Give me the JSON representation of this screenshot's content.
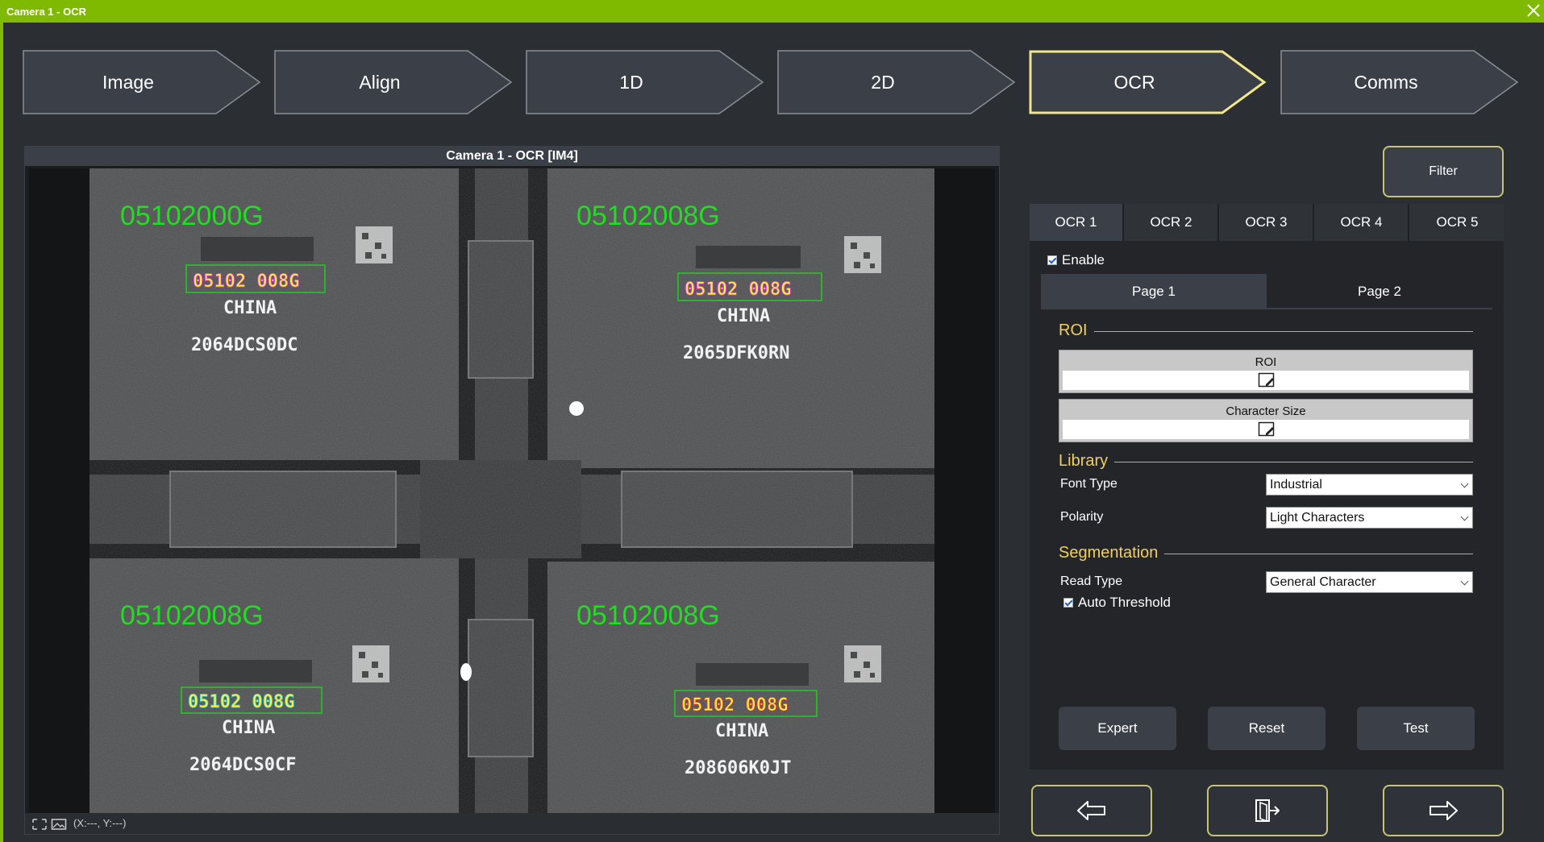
{
  "window": {
    "title": "Camera 1 - OCR"
  },
  "steps": [
    {
      "label": "Image"
    },
    {
      "label": "Align"
    },
    {
      "label": "1D"
    },
    {
      "label": "2D"
    },
    {
      "label": "OCR",
      "active": true
    },
    {
      "label": "Comms"
    }
  ],
  "camera": {
    "header": "Camera 1 - OCR  [IM4]",
    "coords": "(X:---, Y:---)",
    "chips": [
      {
        "id_text": "05102000G",
        "marking": "05102 008G",
        "country": "CHINA",
        "lot": "2064DCS0DC"
      },
      {
        "id_text": "05102008G",
        "marking": "05102 008G",
        "country": "CHINA",
        "lot": "2065DFK0RN"
      },
      {
        "id_text": "05102008G",
        "marking": "05102 008G",
        "country": "CHINA",
        "lot": "2064DCS0CF"
      },
      {
        "id_text": "05102008G",
        "marking": "05102 008G",
        "country": "CHINA",
        "lot": "208606K0JT"
      }
    ]
  },
  "filter": {
    "label": "Filter"
  },
  "ocr_tabs": [
    "OCR 1",
    "OCR 2",
    "OCR 3",
    "OCR 4",
    "OCR 5"
  ],
  "enable": {
    "label": "Enable",
    "checked": true
  },
  "pages": [
    "Page 1",
    "Page 2"
  ],
  "roi": {
    "section": "ROI",
    "roi_label": "ROI",
    "char_size_label": "Character Size"
  },
  "library": {
    "section": "Library",
    "font_type_label": "Font Type",
    "font_type_value": "Industrial",
    "polarity_label": "Polarity",
    "polarity_value": "Light Characters"
  },
  "segmentation": {
    "section": "Segmentation",
    "read_type_label": "Read Type",
    "read_type_value": "General Character",
    "auto_threshold_label": "Auto Threshold",
    "auto_threshold_checked": true
  },
  "actions": {
    "expert": "Expert",
    "reset": "Reset",
    "test": "Test"
  },
  "colors": {
    "accent": "#7fba00",
    "highlight": "#f0e68c",
    "ocr_green": "#22dd22"
  }
}
